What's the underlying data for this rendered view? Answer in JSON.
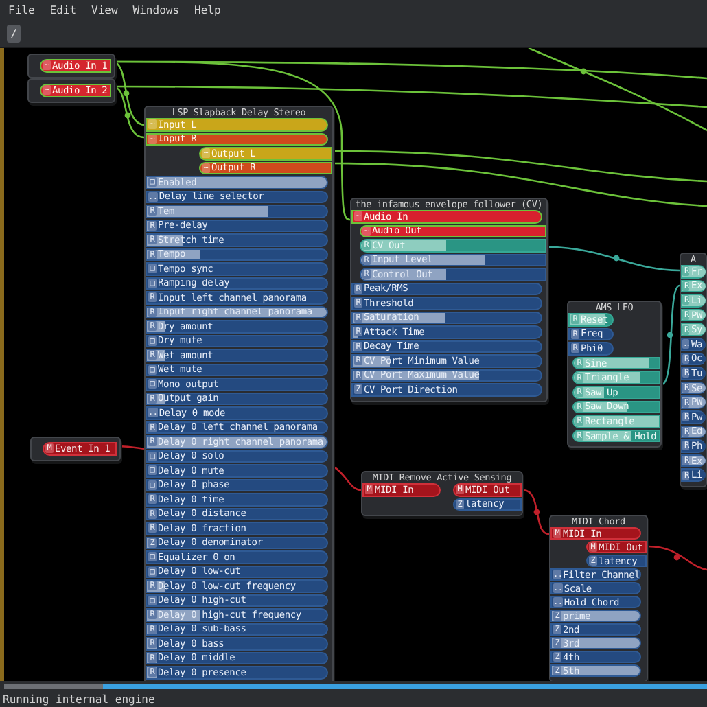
{
  "menu": [
    {
      "label": "File"
    },
    {
      "label": "Edit"
    },
    {
      "label": "View"
    },
    {
      "label": "Windows"
    },
    {
      "label": "Help"
    }
  ],
  "toolbar": {
    "path_button": "/"
  },
  "canvas": {
    "nodes": [
      {
        "kind": "io",
        "ports": [
          {
            "label": "Audio In 1",
            "icon": "~",
            "kind": "audio_out",
            "color": "#d4262e"
          }
        ]
      },
      {
        "kind": "io",
        "ports": [
          {
            "label": "Audio In 2",
            "icon": "~",
            "kind": "audio_out",
            "color": "#d4262e"
          }
        ]
      },
      {
        "kind": "io",
        "ports": [
          {
            "label": "Event In 1",
            "icon": "M",
            "kind": "event_out"
          }
        ]
      },
      {
        "kind": "plugin",
        "title": "LSP Slapback Delay Stereo",
        "ports": [
          {
            "label": "Input L",
            "icon": "~",
            "kind": "audio_in",
            "color": "#c9a61a"
          },
          {
            "label": "Input R",
            "icon": "~",
            "kind": "audio_in",
            "color": "#cf4a1c"
          },
          {
            "label": "Output L",
            "icon": "~",
            "kind": "audio_out",
            "color": "#c9a61a"
          },
          {
            "label": "Output R",
            "icon": "~",
            "kind": "audio_out",
            "color": "#cf4a1c"
          },
          {
            "label": "Enabled",
            "icon": "□",
            "kind": "control_in",
            "level": 1
          },
          {
            "label": "Delay line selector",
            "icon": "..",
            "kind": "control_in",
            "level": 0
          },
          {
            "label": "Tem",
            "icon": "R",
            "kind": "control_in",
            "level": 0.67
          },
          {
            "label": "Pre-delay",
            "icon": "R",
            "kind": "control_in",
            "level": 0.03
          },
          {
            "label": "Stretch time",
            "icon": "R",
            "kind": "control_in",
            "level": 0.2
          },
          {
            "label": "Tempo",
            "icon": "R",
            "kind": "control_in",
            "level": 0.3
          },
          {
            "label": "Tempo sync",
            "icon": "□",
            "kind": "control_in",
            "level": 0
          },
          {
            "label": "Ramping delay",
            "icon": "□",
            "kind": "control_in",
            "level": 0
          },
          {
            "label": "Input left channel panorama",
            "icon": "R",
            "kind": "control_in",
            "level": 0
          },
          {
            "label": "Input right channel panorama",
            "icon": "R",
            "kind": "control_in",
            "level": 1
          },
          {
            "label": "Dry amount",
            "icon": "R",
            "kind": "control_in",
            "level": 0.1
          },
          {
            "label": "Dry mute",
            "icon": "□",
            "kind": "control_in",
            "level": 0
          },
          {
            "label": "Wet amount",
            "icon": "R",
            "kind": "control_in",
            "level": 0.1
          },
          {
            "label": "Wet mute",
            "icon": "□",
            "kind": "control_in",
            "level": 0
          },
          {
            "label": "Mono output",
            "icon": "□",
            "kind": "control_in",
            "level": 0
          },
          {
            "label": "Output gain",
            "icon": "R",
            "kind": "control_in",
            "level": 0.1
          },
          {
            "label": "Delay 0 mode",
            "icon": "..",
            "kind": "control_in",
            "level": 0
          },
          {
            "label": "Delay 0 left channel panorama",
            "icon": "R",
            "kind": "control_in",
            "level": 0
          },
          {
            "label": "Delay 0 right channel panorama",
            "icon": "R",
            "kind": "control_in",
            "level": 1
          },
          {
            "label": "Delay 0 solo",
            "icon": "□",
            "kind": "control_in",
            "level": 0
          },
          {
            "label": "Delay 0 mute",
            "icon": "□",
            "kind": "control_in",
            "level": 0
          },
          {
            "label": "Delay 0 phase",
            "icon": "□",
            "kind": "control_in",
            "level": 0
          },
          {
            "label": "Delay 0 time",
            "icon": "R",
            "kind": "control_in",
            "level": 0
          },
          {
            "label": "Delay 0 distance",
            "icon": "R",
            "kind": "control_in",
            "level": 0
          },
          {
            "label": "Delay 0 fraction",
            "icon": "R",
            "kind": "control_in",
            "level": 0
          },
          {
            "label": "Delay 0 denominator",
            "icon": "Z",
            "kind": "control_in",
            "level": 0.04
          },
          {
            "label": "Equalizer 0 on",
            "icon": "□",
            "kind": "control_in",
            "level": 0
          },
          {
            "label": "Delay 0 low-cut",
            "icon": "□",
            "kind": "control_in",
            "level": 0
          },
          {
            "label": "Delay 0 low-cut frequency",
            "icon": "R",
            "kind": "control_in",
            "level": 0.1
          },
          {
            "label": "Delay 0 high-cut",
            "icon": "□",
            "kind": "control_in",
            "level": 0
          },
          {
            "label": "Delay 0 high-cut frequency",
            "icon": "R",
            "kind": "control_in",
            "level": 0.3
          },
          {
            "label": "Delay 0 sub-bass",
            "icon": "R",
            "kind": "control_in",
            "level": 0.05
          },
          {
            "label": "Delay 0 bass",
            "icon": "R",
            "kind": "control_in",
            "level": 0.05
          },
          {
            "label": "Delay 0 middle",
            "icon": "R",
            "kind": "control_in",
            "level": 0.05
          },
          {
            "label": "Delay 0 presence",
            "icon": "R",
            "kind": "control_in",
            "level": 0.05
          }
        ]
      },
      {
        "kind": "plugin",
        "title": "the infamous envelope follower (CV)",
        "ports": [
          {
            "label": "Audio In",
            "icon": "~",
            "kind": "audio_in",
            "color": "#d8202e"
          },
          {
            "label": "Audio Out",
            "icon": "~",
            "kind": "audio_out",
            "color": "#d8202e"
          },
          {
            "label": "CV Out",
            "icon": "R",
            "kind": "cv_out",
            "level": 0.46
          },
          {
            "label": "Input Level",
            "icon": "R",
            "kind": "control_out",
            "level": 0.67
          },
          {
            "label": "Control Out",
            "icon": "R",
            "kind": "control_out",
            "level": 0.46
          },
          {
            "label": "Peak/RMS",
            "icon": "R",
            "kind": "control_in",
            "level": 0
          },
          {
            "label": "Threshold",
            "icon": "R",
            "kind": "control_in",
            "level": 0
          },
          {
            "label": "Saturation",
            "icon": "R",
            "kind": "control_in",
            "level": 0.49
          },
          {
            "label": "Attack Time",
            "icon": "R",
            "kind": "control_in",
            "level": 0.03
          },
          {
            "label": "Decay Time",
            "icon": "R",
            "kind": "control_in",
            "level": 0.03
          },
          {
            "label": "CV Port Minimum Value",
            "icon": "R",
            "kind": "control_in",
            "level": 0.2
          },
          {
            "label": "CV Port Maximum Value",
            "icon": "R",
            "kind": "control_in",
            "level": 0.67
          },
          {
            "label": "CV Port Direction",
            "icon": "Z",
            "kind": "control_in",
            "level": 0
          }
        ]
      },
      {
        "kind": "plugin",
        "title": "AMS LFO",
        "ports": [
          {
            "label": "Reset",
            "icon": "R",
            "kind": "cv_in",
            "level": 0.85
          },
          {
            "label": "Freq",
            "icon": "R",
            "kind": "control_in",
            "level": 0
          },
          {
            "label": "Phi0",
            "icon": "R",
            "kind": "control_in",
            "level": 0
          },
          {
            "label": "Sine",
            "icon": "R",
            "kind": "cv_out",
            "level": 0.88
          },
          {
            "label": "Triangle",
            "icon": "R",
            "kind": "cv_out",
            "level": 0.77
          },
          {
            "label": "Saw Up",
            "icon": "R",
            "kind": "cv_out",
            "level": 0.35
          },
          {
            "label": "Saw Down",
            "icon": "R",
            "kind": "cv_out",
            "level": 0.63
          },
          {
            "label": "Rectangle",
            "icon": "R",
            "kind": "cv_out",
            "level": 1
          },
          {
            "label": "Sample & Hold",
            "icon": "R",
            "kind": "cv_out",
            "level": 0.68
          }
        ]
      },
      {
        "kind": "plugin",
        "title": "A",
        "ports": [
          {
            "label": "Fr",
            "icon": "R",
            "kind": "cv_in",
            "level": 1
          },
          {
            "label": "Ex",
            "icon": "R",
            "kind": "cv_in",
            "level": 1
          },
          {
            "label": "Li",
            "icon": "R",
            "kind": "cv_in",
            "level": 1
          },
          {
            "label": "PW",
            "icon": "R",
            "kind": "cv_in",
            "level": 1
          },
          {
            "label": "Sy",
            "icon": "R",
            "kind": "cv_in",
            "level": 1
          },
          {
            "label": "Wa",
            "icon": "..",
            "kind": "control_in",
            "level": 0
          },
          {
            "label": "Oc",
            "icon": "R",
            "kind": "control_in",
            "level": 0
          },
          {
            "label": "Tu",
            "icon": "R",
            "kind": "control_in",
            "level": 0
          },
          {
            "label": "Se",
            "icon": "R",
            "kind": "control_in",
            "level": 1
          },
          {
            "label": "PW",
            "icon": "R",
            "kind": "control_in",
            "level": 1
          },
          {
            "label": "Pw",
            "icon": "R",
            "kind": "control_in",
            "level": 0
          },
          {
            "label": "Ed",
            "icon": "R",
            "kind": "control_in",
            "level": 1
          },
          {
            "label": "Ph",
            "icon": "R",
            "kind": "control_in",
            "level": 0
          },
          {
            "label": "Ex",
            "icon": "R",
            "kind": "control_in",
            "level": 1
          },
          {
            "label": "Li",
            "icon": "R",
            "kind": "control_in",
            "level": 0
          }
        ]
      },
      {
        "kind": "plugin",
        "title": "MIDI Remove Active Sensing",
        "ports": [
          {
            "label": "MIDI In",
            "icon": "M",
            "kind": "event_in"
          },
          {
            "label": "MIDI Out",
            "icon": "M",
            "kind": "event_out"
          },
          {
            "label": "latency",
            "icon": "Z",
            "kind": "control_out",
            "level": 0
          }
        ]
      },
      {
        "kind": "plugin",
        "title": "MIDI Chord",
        "ports": [
          {
            "label": "MIDI In",
            "icon": "M",
            "kind": "event_in"
          },
          {
            "label": "MIDI Out",
            "icon": "M",
            "kind": "event_out"
          },
          {
            "label": "latency",
            "icon": "Z",
            "kind": "control_out",
            "level": 0
          },
          {
            "label": "Filter Channel",
            "icon": "..",
            "kind": "control_in",
            "level": 0
          },
          {
            "label": "Scale",
            "icon": "..",
            "kind": "control_in",
            "level": 0
          },
          {
            "label": "Hold Chord",
            "icon": "..",
            "kind": "control_in",
            "level": 0
          },
          {
            "label": "prime",
            "icon": "Z",
            "kind": "control_in",
            "level": 1
          },
          {
            "label": "2nd",
            "icon": "Z",
            "kind": "control_in",
            "level": 0
          },
          {
            "label": "3rd",
            "icon": "Z",
            "kind": "control_in",
            "level": 1
          },
          {
            "label": "4th",
            "icon": "Z",
            "kind": "control_in",
            "level": 0
          },
          {
            "label": "5th",
            "icon": "Z",
            "kind": "control_in",
            "level": 1
          }
        ]
      }
    ]
  },
  "status_bar": "Running internal engine"
}
